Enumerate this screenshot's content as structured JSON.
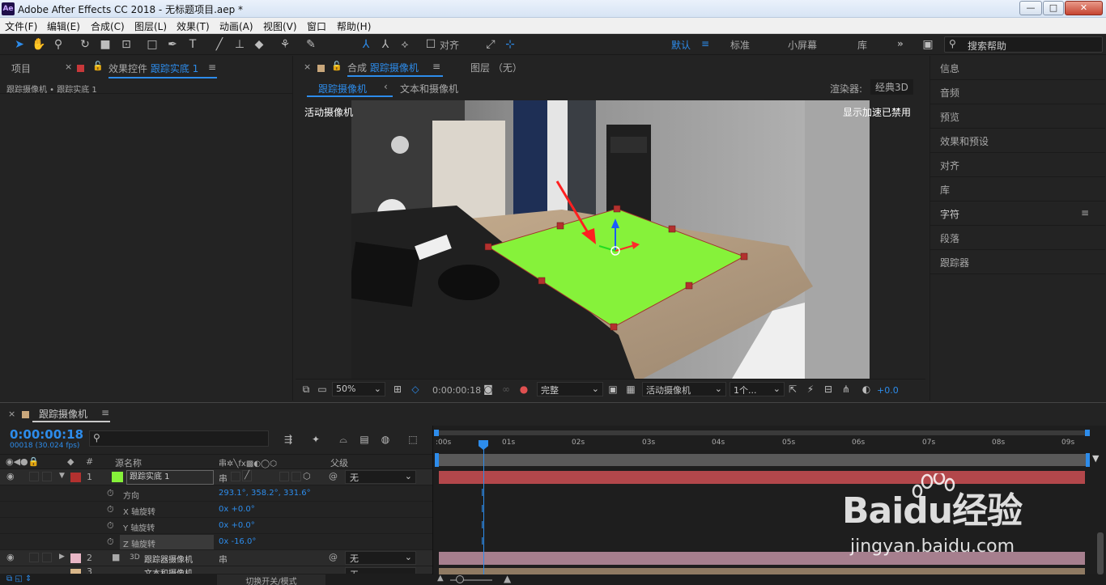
{
  "window": {
    "title": "Adobe After Effects CC 2018 - 无标题项目.aep *",
    "logo": "Ae",
    "buttons": [
      "—",
      "□",
      "✕"
    ]
  },
  "menu": [
    "文件(F)",
    "编辑(E)",
    "合成(C)",
    "图层(L)",
    "效果(T)",
    "动画(A)",
    "视图(V)",
    "窗口",
    "帮助(H)"
  ],
  "toolbar": {
    "align_label": "对齐",
    "workspaces": [
      "默认",
      "标准",
      "小屏幕",
      "库"
    ],
    "active_workspace": "默认",
    "search_placeholder": "搜索帮助"
  },
  "left_panel": {
    "tab_project": "项目",
    "tab_effects_prefix": "效果控件",
    "tab_effects_layer": "跟踪实底 1",
    "breadcrumb": "跟踪摄像机 • 跟踪实底 1"
  },
  "comp_panel": {
    "tab_prefix": "合成",
    "tab_name": "跟踪摄像机",
    "layer_tab": "图层 （无）",
    "sub_tab_active": "跟踪摄像机",
    "sub_tab_other": "文本和摄像机",
    "renderer_label": "渲染器:",
    "renderer_value": "经典3D",
    "camera_label": "活动摄像机",
    "accel_label": "显示加速已禁用"
  },
  "viewer_bar": {
    "zoom": "50%",
    "timecode": "0:00:00:18",
    "resolution": "完整",
    "camera": "活动摄像机",
    "views": "1个...",
    "exposure": "+0.0"
  },
  "right_panel": [
    "信息",
    "音频",
    "预览",
    "效果和预设",
    "对齐",
    "库",
    "字符",
    "段落",
    "跟踪器"
  ],
  "timeline": {
    "comp_name": "跟踪摄像机",
    "timecode": "0:00:00:18",
    "frame_info": "00018 (30.024 fps)",
    "search_placeholder": "",
    "col_hash": "#",
    "col_source": "源名称",
    "col_parent": "父级",
    "ruler": [
      ":00s",
      "01s",
      "02s",
      "03s",
      "04s",
      "05s",
      "06s",
      "07s",
      "08s",
      "09s"
    ],
    "layers": [
      {
        "num": "1",
        "name": "跟踪实底 1",
        "parent": "无",
        "label_color": "#b3312f",
        "thumb_color": "#86f23a"
      },
      {
        "num": "2",
        "name": "跟踪器摄像机",
        "parent": "无",
        "label_color": "#e9b6c6"
      },
      {
        "num": "3",
        "name": "文本和摄像机",
        "parent": "无",
        "label_color": "#d9b78a"
      }
    ],
    "properties": [
      {
        "name": "方向",
        "value": "293.1°, 358.2°, 331.6°"
      },
      {
        "name": "X 轴旋转",
        "value": "0x +0.0°"
      },
      {
        "name": "Y 轴旋转",
        "value": "0x +0.0°"
      },
      {
        "name": "Z 轴旋转",
        "value": "0x -16.0°"
      }
    ],
    "layer2_3d_badge": "3D",
    "layer2_parent_symbol": "@",
    "footer_toggle": "切换开关/模式"
  },
  "watermark": {
    "brand": "Baidu经验",
    "url": "jingyan.baidu.com"
  },
  "colors": {
    "accent": "#2d8ceb",
    "solid": "#86f23a",
    "track_red": "#b3474b",
    "track_pink": "#a67f8e"
  },
  "icons": [
    "selection-tool-icon",
    "hand-tool-icon",
    "zoom-tool-icon",
    "rotate-tool-icon",
    "camera-tool-icon",
    "pan-behind-icon",
    "rectangle-tool-icon",
    "pen-tool-icon",
    "text-tool-icon",
    "brush-tool-icon",
    "clone-stamp-icon",
    "eraser-icon",
    "roto-brush-icon",
    "puppet-pin-icon"
  ]
}
